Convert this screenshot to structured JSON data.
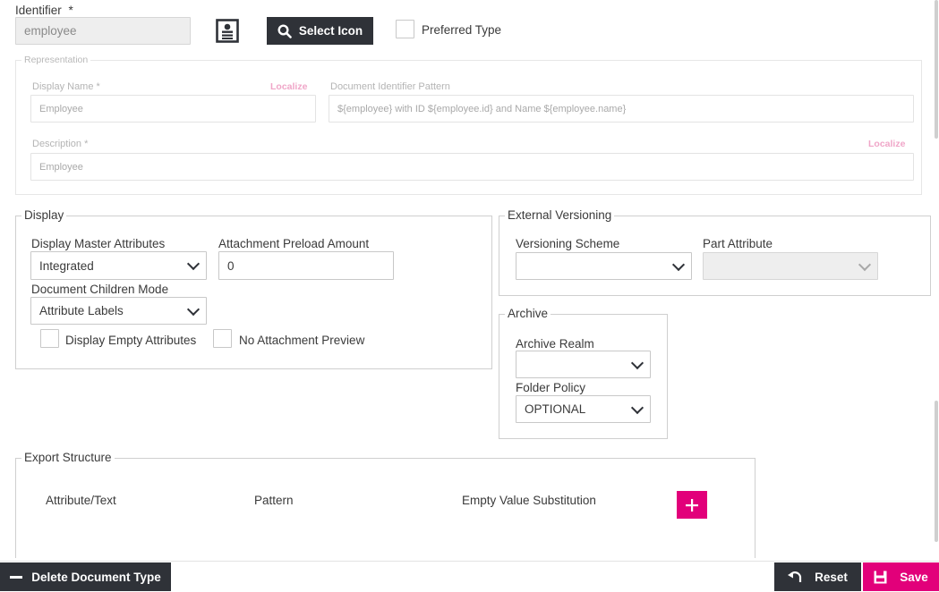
{
  "identifier": {
    "label": "Identifier",
    "required_mark": "*",
    "value": "employee",
    "select_icon_label": "Select Icon",
    "preferred_type_label": "Preferred Type",
    "preferred_type_checked": false
  },
  "representation": {
    "legend": "Representation",
    "display_name_label": "Display Name *",
    "display_name_localize": "Localize",
    "display_name_value": "Employee",
    "doc_id_pattern_label": "Document Identifier Pattern",
    "doc_id_pattern_value": "${employee} with ID ${employee.id} and Name ${employee.name}",
    "description_label": "Description *",
    "description_localize": "Localize",
    "description_value": "Employee"
  },
  "display": {
    "legend": "Display",
    "master_attributes_label": "Display Master Attributes",
    "master_attributes_value": "Integrated",
    "preload_label": "Attachment Preload Amount",
    "preload_value": "0",
    "children_mode_label": "Document Children Mode",
    "children_mode_value": "Attribute Labels",
    "empty_attributes_label": "Display Empty Attributes",
    "no_preview_label": "No Attachment Preview"
  },
  "external_versioning": {
    "legend": "External Versioning",
    "scheme_label": "Versioning Scheme",
    "scheme_value": "",
    "part_attribute_label": "Part Attribute",
    "part_attribute_value": ""
  },
  "archive": {
    "legend": "Archive",
    "realm_label": "Archive Realm",
    "realm_value": "",
    "folder_policy_label": "Folder Policy",
    "folder_policy_value": "OPTIONAL"
  },
  "export_structure": {
    "legend": "Export Structure",
    "columns": [
      "Attribute/Text",
      "Pattern",
      "Empty Value Substitution"
    ]
  },
  "footer": {
    "delete_label": "Delete Document Type",
    "reset_label": "Reset",
    "save_label": "Save"
  },
  "colors": {
    "accent": "#e2007a",
    "dark_button": "#2f3238",
    "localize": "#f0a6c8"
  },
  "icons": {
    "document_icon": "id-card-icon",
    "search": "search-icon",
    "add": "plus-icon",
    "delete": "minus-icon",
    "reset": "undo-icon",
    "save": "floppy-disk-icon"
  }
}
